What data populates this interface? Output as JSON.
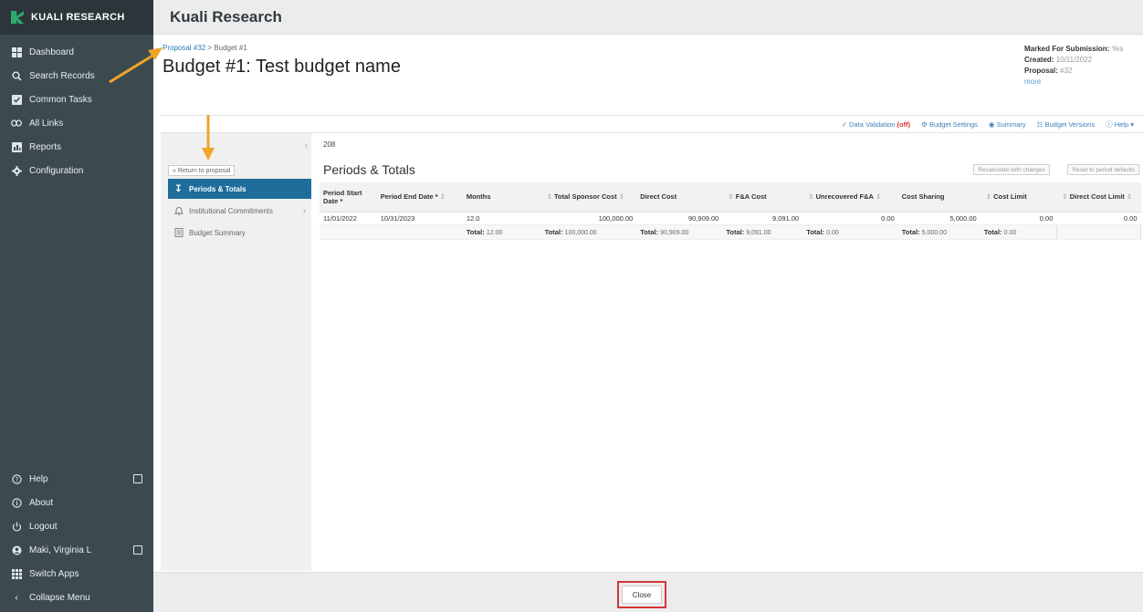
{
  "sidebar": {
    "brand": "KUALI RESEARCH",
    "items": [
      {
        "label": "Dashboard",
        "icon": "dashboard-icon"
      },
      {
        "label": "Search Records",
        "icon": "search-icon"
      },
      {
        "label": "Common Tasks",
        "icon": "checkbox-icon"
      },
      {
        "label": "All Links",
        "icon": "link-icon"
      },
      {
        "label": "Reports",
        "icon": "reports-icon"
      },
      {
        "label": "Configuration",
        "icon": "gear-icon"
      }
    ],
    "bottom": [
      {
        "label": "Help",
        "icon": "help-icon"
      },
      {
        "label": "About",
        "icon": "info-icon"
      },
      {
        "label": "Logout",
        "icon": "power-icon"
      },
      {
        "label": "Maki, Virginia L",
        "icon": "user-icon"
      },
      {
        "label": "Switch Apps",
        "icon": "grid-icon"
      },
      {
        "label": "Collapse Menu",
        "icon": "chevron-left-icon"
      }
    ]
  },
  "header": {
    "title": "Kuali Research"
  },
  "breadcrumb": {
    "link": "Proposal #32",
    "sep": ">",
    "current": "Budget #1"
  },
  "page_title": "Budget #1: Test budget name",
  "meta": {
    "submission_label": "Marked For Submission:",
    "submission_value": "Yes",
    "created_label": "Created:",
    "created_value": "10/11/2022",
    "proposal_label": "Proposal:",
    "proposal_value": "#32",
    "more": "more"
  },
  "toolbar": {
    "data_validation": "Data Validation",
    "validation_state": "(off)",
    "budget_settings": "Budget Settings",
    "summary": "Summary",
    "budget_versions": "Budget Versions",
    "help": "Help"
  },
  "subnav": {
    "return": "« Return to proposal",
    "items": [
      {
        "label": "Periods & Totals"
      },
      {
        "label": "Institutional Commitments"
      },
      {
        "label": "Budget Summary"
      }
    ]
  },
  "content": {
    "id": "208",
    "section_title": "Periods & Totals",
    "recalc": "Recalculate with changes",
    "reset": "Reset to period defaults",
    "columns": [
      "Period Start Date *",
      "Period End Date *",
      "Months",
      "Total Sponsor Cost",
      "Direct Cost",
      "F&A Cost",
      "Unrecovered F&A",
      "Cost Sharing",
      "Cost Limit",
      "Direct Cost Limit"
    ],
    "row": [
      "11/01/2022",
      "10/31/2023",
      "12.0",
      "100,000.00",
      "90,909.00",
      "9,091.00",
      "0.00",
      "5,000.00",
      "0.00",
      "0.00"
    ],
    "total_label": "Total:",
    "totals": [
      "12.00",
      "100,000.00",
      "90,909.00",
      "9,091.00",
      "0.00",
      "5,000.00",
      "0.00"
    ]
  },
  "footer": {
    "close": "Close"
  },
  "colors": {
    "sidebar": "#3c4a50",
    "active": "#1f6d9b",
    "highlight": "#d23636",
    "annotation_arrow": "#f0a526"
  }
}
